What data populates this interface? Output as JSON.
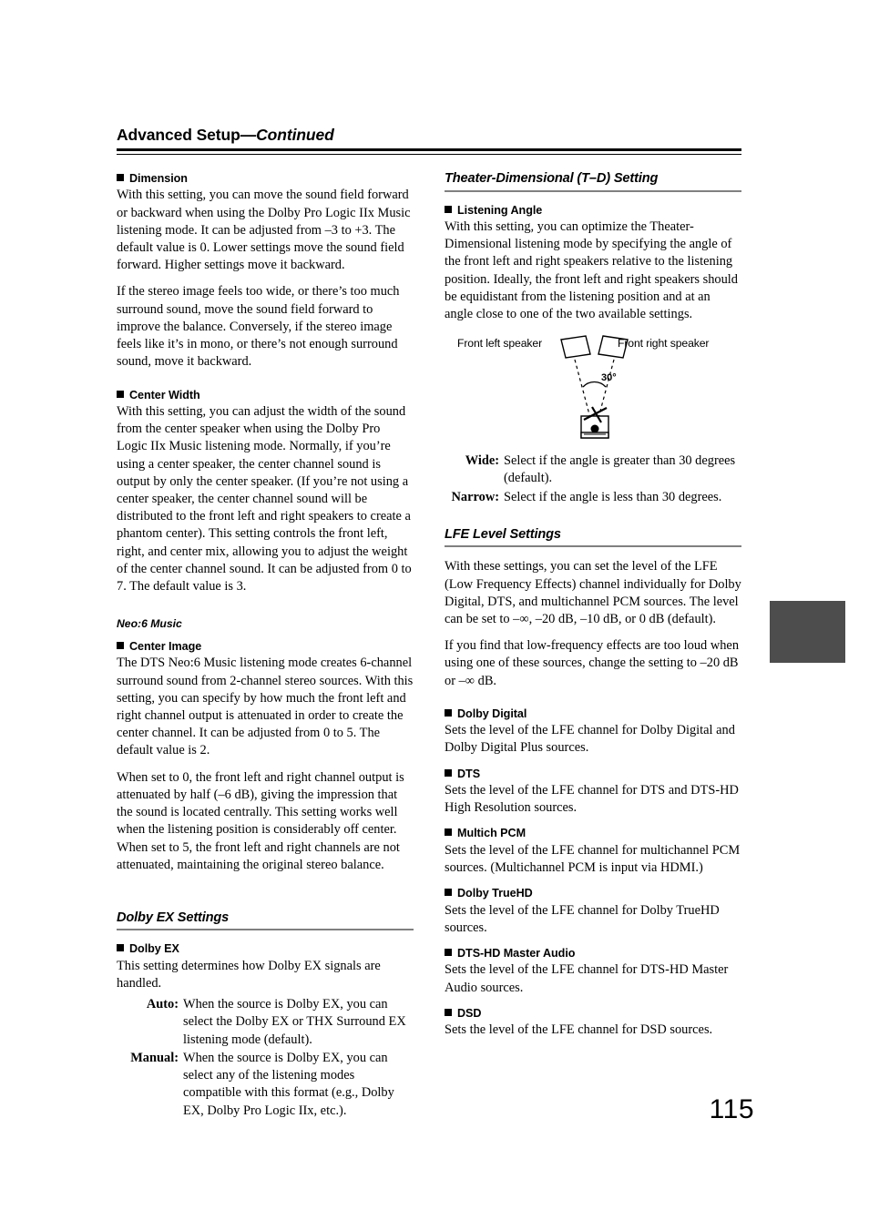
{
  "header": {
    "title": "Advanced Setup",
    "continued": "—Continued"
  },
  "folio": "115",
  "left_column": {
    "dimension": {
      "heading": "Dimension",
      "paragraphs": [
        "With this setting, you can move the sound field forward or backward when using the Dolby Pro Logic IIx Music listening mode. It can be adjusted from –3 to +3. The default value is 0. Lower settings move the sound field forward. Higher settings move it backward.",
        "If the stereo image feels too wide, or there’s too much surround sound, move the sound field forward to improve the balance. Conversely, if the stereo image feels like it’s in mono, or there’s not enough surround sound, move it backward."
      ]
    },
    "center_width": {
      "heading": "Center Width",
      "paragraphs": [
        "With this setting, you can adjust the width of the sound from the center speaker when using the Dolby Pro Logic IIx Music listening mode. Normally, if you’re using a center speaker, the center channel sound is output by only the center speaker. (If you’re not using a center speaker, the center channel sound will be distributed to the front left and right speakers to create a phantom center). This setting controls the front left, right, and center mix, allowing you to adjust the weight of the center channel sound. It can be adjusted from 0 to 7. The default value is 3."
      ]
    },
    "neo6_music_label": "Neo:6 Music",
    "center_image": {
      "heading": "Center Image",
      "paragraphs": [
        "The DTS Neo:6 Music listening mode creates 6-channel surround sound from 2-channel stereo sources. With this setting, you can specify by how much the front left and right channel output is attenuated in order to create the center channel. It can be adjusted from 0 to 5. The default value is 2.",
        "When set to 0, the front left and right channel output is attenuated by half (–6 dB), giving the impression that the sound is located centrally. This setting works well when the listening position is considerably off center. When set to 5, the front left and right channels are not attenuated, maintaining the original stereo balance."
      ]
    },
    "dolby_ex_settings": {
      "section_title": "Dolby EX Settings",
      "dolby_ex": {
        "heading": "Dolby EX",
        "intro": "This setting determines how Dolby EX signals are handled.",
        "options": [
          {
            "term": "Auto:",
            "definition": "When the source is Dolby EX, you can select the Dolby EX or THX Surround EX listening mode (default)."
          },
          {
            "term": "Manual:",
            "definition": "When the source is Dolby EX, you can select any of the listening modes compatible with this format (e.g., Dolby EX, Dolby Pro Logic IIx, etc.)."
          }
        ]
      }
    }
  },
  "right_column": {
    "theater_dimensional": {
      "section_title": "Theater-Dimensional (T–D) Setting",
      "listening_angle": {
        "heading": "Listening Angle",
        "paragraphs": [
          "With this setting, you can optimize the Theater-Dimensional listening mode by specifying the angle of the front left and right speakers relative to the listening position. Ideally, the front left and right speakers should be equidistant from the listening position and at an angle close to one of the two available settings."
        ],
        "diagram": {
          "left_speaker_label": "Front left speaker",
          "right_speaker_label": "Front right speaker",
          "angle_label": "30°"
        },
        "options": [
          {
            "term": "Wide:",
            "definition": "Select if the angle is greater than 30 degrees (default)."
          },
          {
            "term": "Narrow:",
            "definition": "Select if the angle is less than 30 degrees."
          }
        ]
      }
    },
    "lfe_level_settings": {
      "section_title": "LFE Level Settings",
      "paragraphs": [
        "With these settings, you can set the level of the LFE (Low Frequency Effects) channel individually for Dolby Digital, DTS, and multichannel PCM sources. The level can be set to –∞, –20 dB, –10 dB, or 0 dB (default).",
        "If you find that low-frequency effects are too loud when using one of these sources, change the setting to –20 dB or –∞ dB."
      ],
      "items": [
        {
          "heading": "Dolby Digital",
          "body": "Sets the level of the LFE channel for Dolby Digital and Dolby Digital Plus sources."
        },
        {
          "heading": "DTS",
          "body": "Sets the level of the LFE channel for DTS and DTS-HD High Resolution sources."
        },
        {
          "heading": "Multich PCM",
          "body": "Sets the level of the LFE channel for multichannel PCM sources. (Multichannel PCM is input via HDMI.)"
        },
        {
          "heading": "Dolby TrueHD",
          "body": "Sets the level of the LFE channel for Dolby TrueHD sources."
        },
        {
          "heading": "DTS-HD Master Audio",
          "body": "Sets the level of the LFE channel for DTS-HD Master Audio sources."
        },
        {
          "heading": "DSD",
          "body": "Sets the level of the LFE channel for DSD sources."
        }
      ]
    }
  },
  "colors": {
    "text": "#000000",
    "section_rule": "#808080",
    "thumb_tab": "#4d4d4d",
    "page_background": "#ffffff"
  }
}
